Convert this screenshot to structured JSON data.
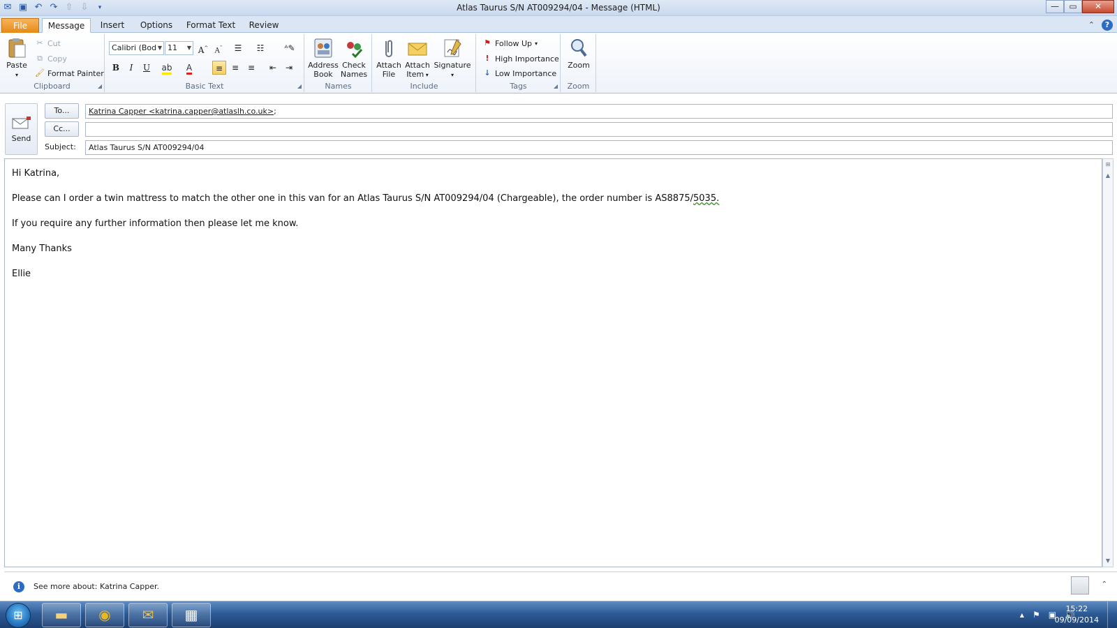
{
  "window": {
    "title": "Atlas Taurus S/N AT009294/04  -  Message (HTML)",
    "controls": {
      "minimize": "—",
      "maximize": "▭",
      "close": "✕"
    }
  },
  "qat": [
    "save-icon",
    "undo-icon",
    "redo-icon",
    "up-icon",
    "down-icon",
    "customize-icon"
  ],
  "tabs": [
    "File",
    "Message",
    "Insert",
    "Options",
    "Format Text",
    "Review"
  ],
  "ribbon": {
    "clipboard": {
      "label": "Clipboard",
      "paste": "Paste",
      "cut": "Cut",
      "copy": "Copy",
      "format_painter": "Format Painter"
    },
    "basic_text": {
      "label": "Basic Text",
      "font": "Calibri (Bod",
      "size": "11",
      "bold": "B",
      "italic": "I",
      "underline": "U"
    },
    "names": {
      "label": "Names",
      "address_book_1": "Address",
      "address_book_2": "Book",
      "check_names_1": "Check",
      "check_names_2": "Names"
    },
    "include": {
      "label": "Include",
      "attach_file_1": "Attach",
      "attach_file_2": "File",
      "attach_item_1": "Attach",
      "attach_item_2": "Item",
      "signature": "Signature"
    },
    "tags": {
      "label": "Tags",
      "follow_up": "Follow Up",
      "high_importance": "High Importance",
      "low_importance": "Low Importance"
    },
    "zoom": {
      "label": "Zoom",
      "zoom": "Zoom"
    }
  },
  "header": {
    "send": "Send",
    "to_button": "To...",
    "cc_button": "Cc...",
    "subject_label": "Subject:",
    "to_value": "Katrina Capper <katrina.capper@atlaslh.co.uk>",
    "to_suffix": ";",
    "cc_value": "",
    "subject_value": "Atlas Taurus S/N AT009294/04"
  },
  "body": {
    "greeting": "Hi Katrina,",
    "para1": "Please can I order a twin mattress to match the other one in this van for an Atlas Taurus S/N AT009294/04 (Chargeable), the order number is AS8875/",
    "para1_flagged": "5035.",
    "para2": "If you require any further information then please let me know.",
    "closing": "Many Thanks",
    "signature": "Ellie"
  },
  "people_pane": {
    "text": "See more about: Katrina Capper."
  },
  "taskbar": {
    "time": "15:22",
    "date": "09/09/2014",
    "apps": [
      "explorer-icon",
      "chrome-icon",
      "outlook-icon",
      "calendar-app-icon"
    ]
  },
  "colors": {
    "file_tab": "#e58a16",
    "accent_blue": "#2e6bc2",
    "taskbar": "#2d5b96"
  }
}
